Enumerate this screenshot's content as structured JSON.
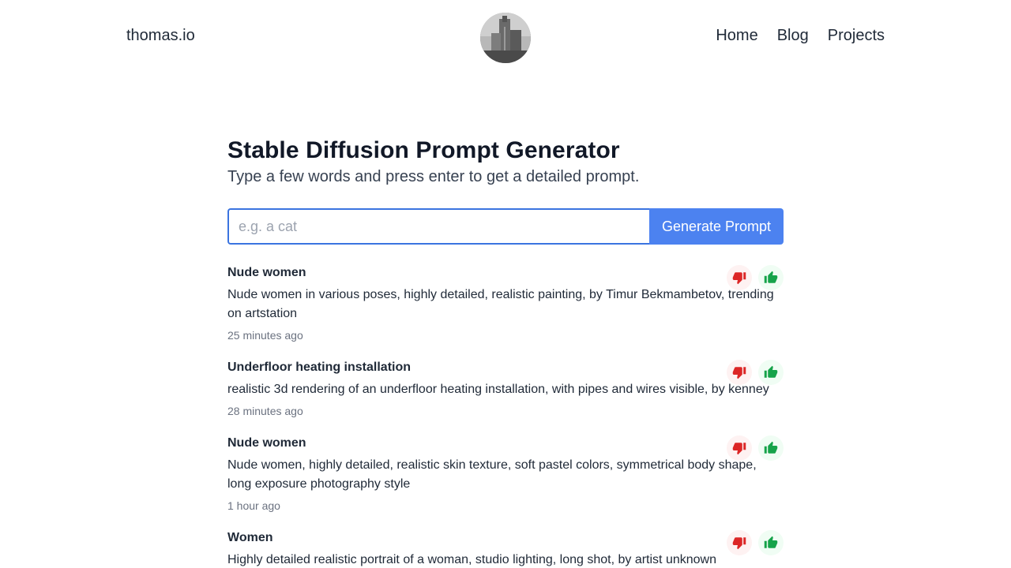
{
  "header": {
    "site_name": "thomas.io",
    "nav": [
      {
        "label": "Home"
      },
      {
        "label": "Blog"
      },
      {
        "label": "Projects"
      }
    ]
  },
  "main": {
    "title": "Stable Diffusion Prompt Generator",
    "subtitle": "Type a few words and press enter to get a detailed prompt.",
    "search": {
      "placeholder": "e.g. a cat",
      "value": ""
    },
    "generate_label": "Generate Prompt"
  },
  "prompts": [
    {
      "title": "Nude women",
      "text": "Nude women in various poses, highly detailed, realistic painting, by Timur Bekmambetov, trending on artstation",
      "time": "25 minutes ago"
    },
    {
      "title": "Underfloor heating installation",
      "text": "realistic 3d rendering of an underfloor heating installation, with pipes and wires visible, by kenney",
      "time": "28 minutes ago"
    },
    {
      "title": "Nude women",
      "text": "Nude women, highly detailed, realistic skin texture, soft pastel colors, symmetrical body shape, long exposure photography style",
      "time": "1 hour ago"
    },
    {
      "title": "Women",
      "text": "Highly detailed realistic portrait of a woman, studio lighting, long shot, by artist unknown",
      "time": ""
    }
  ],
  "icons": {
    "downvote": "thumbs-down-icon",
    "upvote": "thumbs-up-icon"
  },
  "colors": {
    "accent": "#4c82f0",
    "downvote": "#dc2626",
    "upvote": "#16a34a"
  }
}
